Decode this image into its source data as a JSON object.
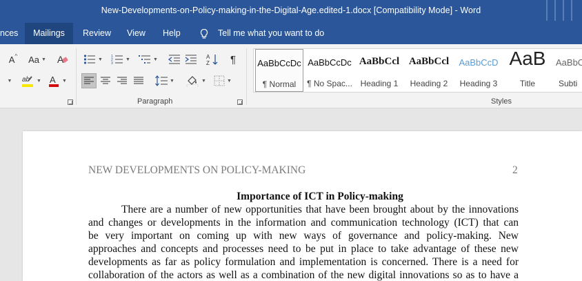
{
  "window": {
    "title": "New-Developments-on-Policy-making-in-the-Digital-Age.edited-1.docx [Compatibility Mode]  -  Word"
  },
  "tabs": [
    {
      "label": "nces"
    },
    {
      "label": "Mailings"
    },
    {
      "label": "Review"
    },
    {
      "label": "View"
    },
    {
      "label": "Help"
    }
  ],
  "tell_me": {
    "label": "Tell me what you want to do"
  },
  "ribbon": {
    "font_group": {
      "grow_font": "A",
      "change_case": "Aa",
      "highlight_color": "#f6e800",
      "font_color": "#d10d0d"
    },
    "paragraph_group": {
      "label": "Paragraph"
    },
    "styles_group": {
      "label": "Styles",
      "items": [
        {
          "sample": "AaBbCcDc",
          "name": "¶ Normal"
        },
        {
          "sample": "AaBbCcDc",
          "name": "¶ No Spac..."
        },
        {
          "sample": "AaBbCcl",
          "name": "Heading 1"
        },
        {
          "sample": "AaBbCcl",
          "name": "Heading 2"
        },
        {
          "sample": "AaBbCcD",
          "name": "Heading 3"
        },
        {
          "sample": "AaB",
          "name": "Title"
        },
        {
          "sample": "AaBbC",
          "name": "Subti"
        }
      ]
    }
  },
  "document": {
    "running_head": "NEW DEVELOPMENTS ON POLICY-MAKING",
    "page_number": "2",
    "heading": "Importance of ICT in Policy-making",
    "lines": [
      "There are a number of new opportunities that have been brought about by the innovations",
      "and changes or developments in the information and communication technology (ICT) that can",
      "be very important on coming up with new ways of governance and policy-making. New",
      "approaches and concepts and processes need to be put in place to take advantage of these new",
      "developments as far as policy formulation and implementation is concerned. There is a need for",
      "collaboration of the actors as well as a combination of the new digital innovations so as to have a"
    ]
  }
}
